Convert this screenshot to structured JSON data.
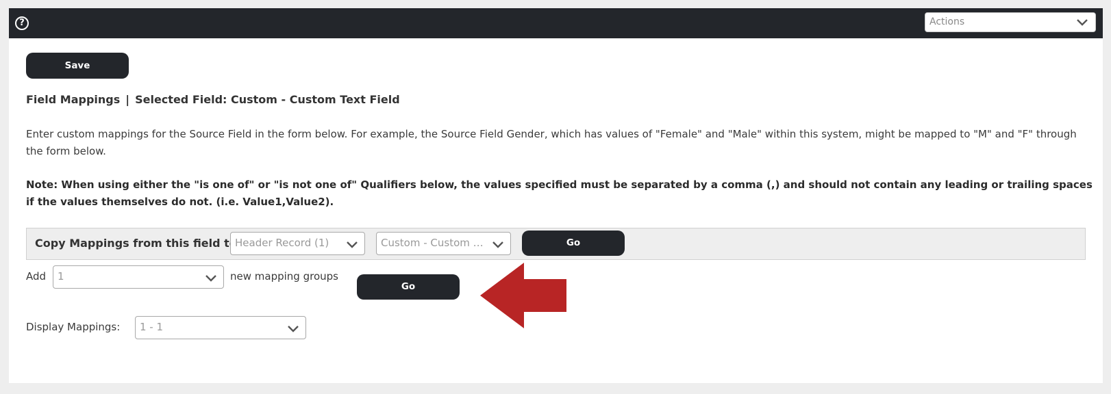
{
  "topbar": {
    "help_icon": "?",
    "actions_select": {
      "value": "Actions"
    }
  },
  "toolbar": {
    "save_label": "Save"
  },
  "heading": {
    "title": "Field Mappings",
    "separator": "|",
    "selected_field": "Selected Field: Custom - Custom Text Field"
  },
  "description": "Enter custom mappings for the Source Field in the form below. For example, the Source Field Gender, which has values of \"Female\" and \"Male\" within this system, might be mapped to \"M\" and \"F\" through the form below.",
  "note": "Note: When using either the \"is one of\" or \"is not one of\" Qualifiers below, the values specified must be separated by a comma (,) and should not contain any leading or trailing spaces if the values themselves do not. (i.e. Value1,Value2).",
  "copy_mappings": {
    "label": "Copy Mappings from this field to:",
    "record_select": "Header Record (1)",
    "field_select": "Custom - Custom Text Field",
    "go_label": "Go"
  },
  "add_groups": {
    "prefix": "Add",
    "count_select": "1",
    "suffix": "new mapping groups",
    "go_label": "Go"
  },
  "display_mappings": {
    "label": "Display Mappings:",
    "range_select": "1 - 1"
  },
  "colors": {
    "topbar": "#23262b",
    "button": "#23262b",
    "arrow": "#b82525"
  }
}
